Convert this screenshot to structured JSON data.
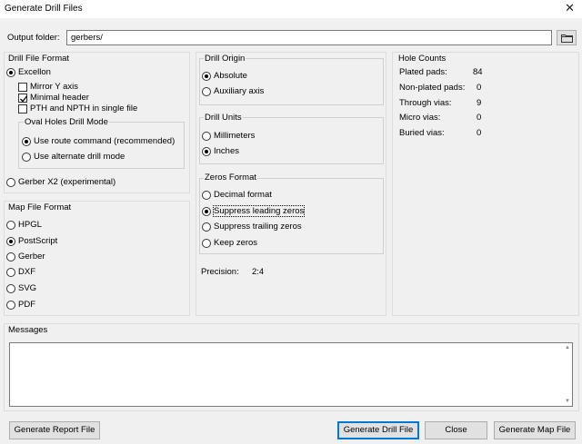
{
  "window": {
    "title": "Generate Drill Files",
    "close_glyph": "✕"
  },
  "output": {
    "label": "Output folder:",
    "value": "gerbers/",
    "browse_icon": "folder-icon"
  },
  "drill_file_format": {
    "title": "Drill File Format",
    "excellon": "Excellon",
    "mirror_y": "Mirror Y axis",
    "minimal_header": "Minimal header",
    "pth_npth": "PTH and NPTH in single file",
    "oval_title": "Oval Holes Drill Mode",
    "use_route": "Use route command (recommended)",
    "use_alternate": "Use alternate drill mode",
    "gerber_x2": "Gerber X2 (experimental)"
  },
  "map_file_format": {
    "title": "Map File Format",
    "options": [
      "HPGL",
      "PostScript",
      "Gerber",
      "DXF",
      "SVG",
      "PDF"
    ]
  },
  "drill_origin": {
    "title": "Drill Origin",
    "absolute": "Absolute",
    "auxiliary": "Auxiliary axis"
  },
  "drill_units": {
    "title": "Drill Units",
    "millimeters": "Millimeters",
    "inches": "Inches"
  },
  "zeros_format": {
    "title": "Zeros Format",
    "options": [
      "Decimal format",
      "Suppress leading zeros",
      "Suppress trailing zeros",
      "Keep zeros"
    ]
  },
  "precision": {
    "label": "Precision:",
    "value": "2:4"
  },
  "hole_counts": {
    "title": "Hole Counts",
    "rows": [
      {
        "label": "Plated pads:",
        "value": "84"
      },
      {
        "label": "Non-plated pads:",
        "value": "0"
      },
      {
        "label": "Through vias:",
        "value": "9"
      },
      {
        "label": "Micro vias:",
        "value": "0"
      },
      {
        "label": "Buried vias:",
        "value": "0"
      }
    ]
  },
  "messages": {
    "title": "Messages"
  },
  "buttons": {
    "report": "Generate Report File",
    "drill": "Generate Drill File",
    "close": "Close",
    "map": "Generate Map File"
  }
}
